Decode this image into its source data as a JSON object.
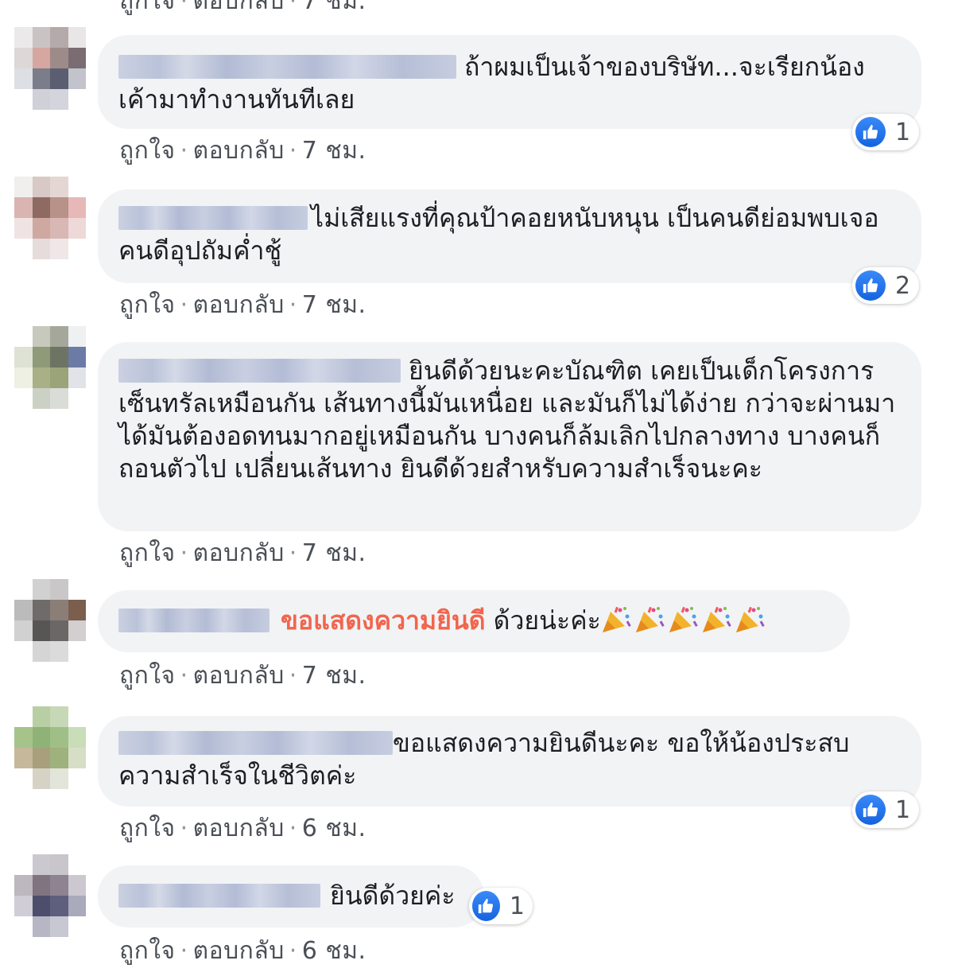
{
  "comments": [
    {
      "text": "ถ้าผมเป็นเจ้าของบริษัท...จะเรียกน้องเค้ามาทำงานทันทีเลย",
      "actions": {
        "like": "ถูกใจ",
        "reply": "ตอบกลับ",
        "time": "7 ชม."
      },
      "reactions": "1"
    },
    {
      "text": "ไม่เสียแรงที่คุณป้าคอยหนับหนุน เป็นคนดีย่อมพบเจอคนดีอุปถัมค่ำชู้",
      "actions": {
        "like": "ถูกใจ",
        "reply": "ตอบกลับ",
        "time": "7 ชม."
      },
      "reactions": "2"
    },
    {
      "text": "ยินดีด้วยนะคะบัณฑิต เคยเป็นเด็กโครงการเซ็นทรัลเหมือนกัน เส้นทางนี้มันเหนื่อย และมันก็ไม่ได้ง่าย กว่าจะผ่านมาได้มันต้องอดทนมากอยู่เหมือนกัน บางคนก็ล้มเลิกไปกลางทาง บางคนก็ถอนตัวไป เปลี่ยนเส้นทาง ยินดีด้วยสำหรับความสำเร็จนะคะ",
      "actions": {
        "like": "ถูกใจ",
        "reply": "ตอบกลับ",
        "time": "7 ชม."
      }
    },
    {
      "highlight": "ขอแสดงความยินดี",
      "text": "ด้วยน่ะค่ะ",
      "emoji": [
        "party-popper-icon",
        "party-popper-icon",
        "party-popper-icon",
        "party-popper-icon",
        "party-popper-icon"
      ],
      "actions": {
        "like": "ถูกใจ",
        "reply": "ตอบกลับ",
        "time": "7 ชม."
      }
    },
    {
      "text": "ขอแสดงความยินดีนะคะ ขอให้น้องประสบความสำเร็จในชีวิตค่ะ",
      "actions": {
        "like": "ถูกใจ",
        "reply": "ตอบกลับ",
        "time": "6 ชม."
      },
      "reactions": "1"
    },
    {
      "text": "ยินดีด้วยค่ะ",
      "actions": {
        "like": "ถูกใจ",
        "reply": "ตอบกลับ",
        "time": "6 ชม."
      },
      "reactions": "1"
    }
  ],
  "colors": {
    "bubble_bg": "#f2f3f5",
    "like_blue": "#1877f2",
    "highlight": "#f0664d",
    "meta_text": "#4b4f56"
  }
}
